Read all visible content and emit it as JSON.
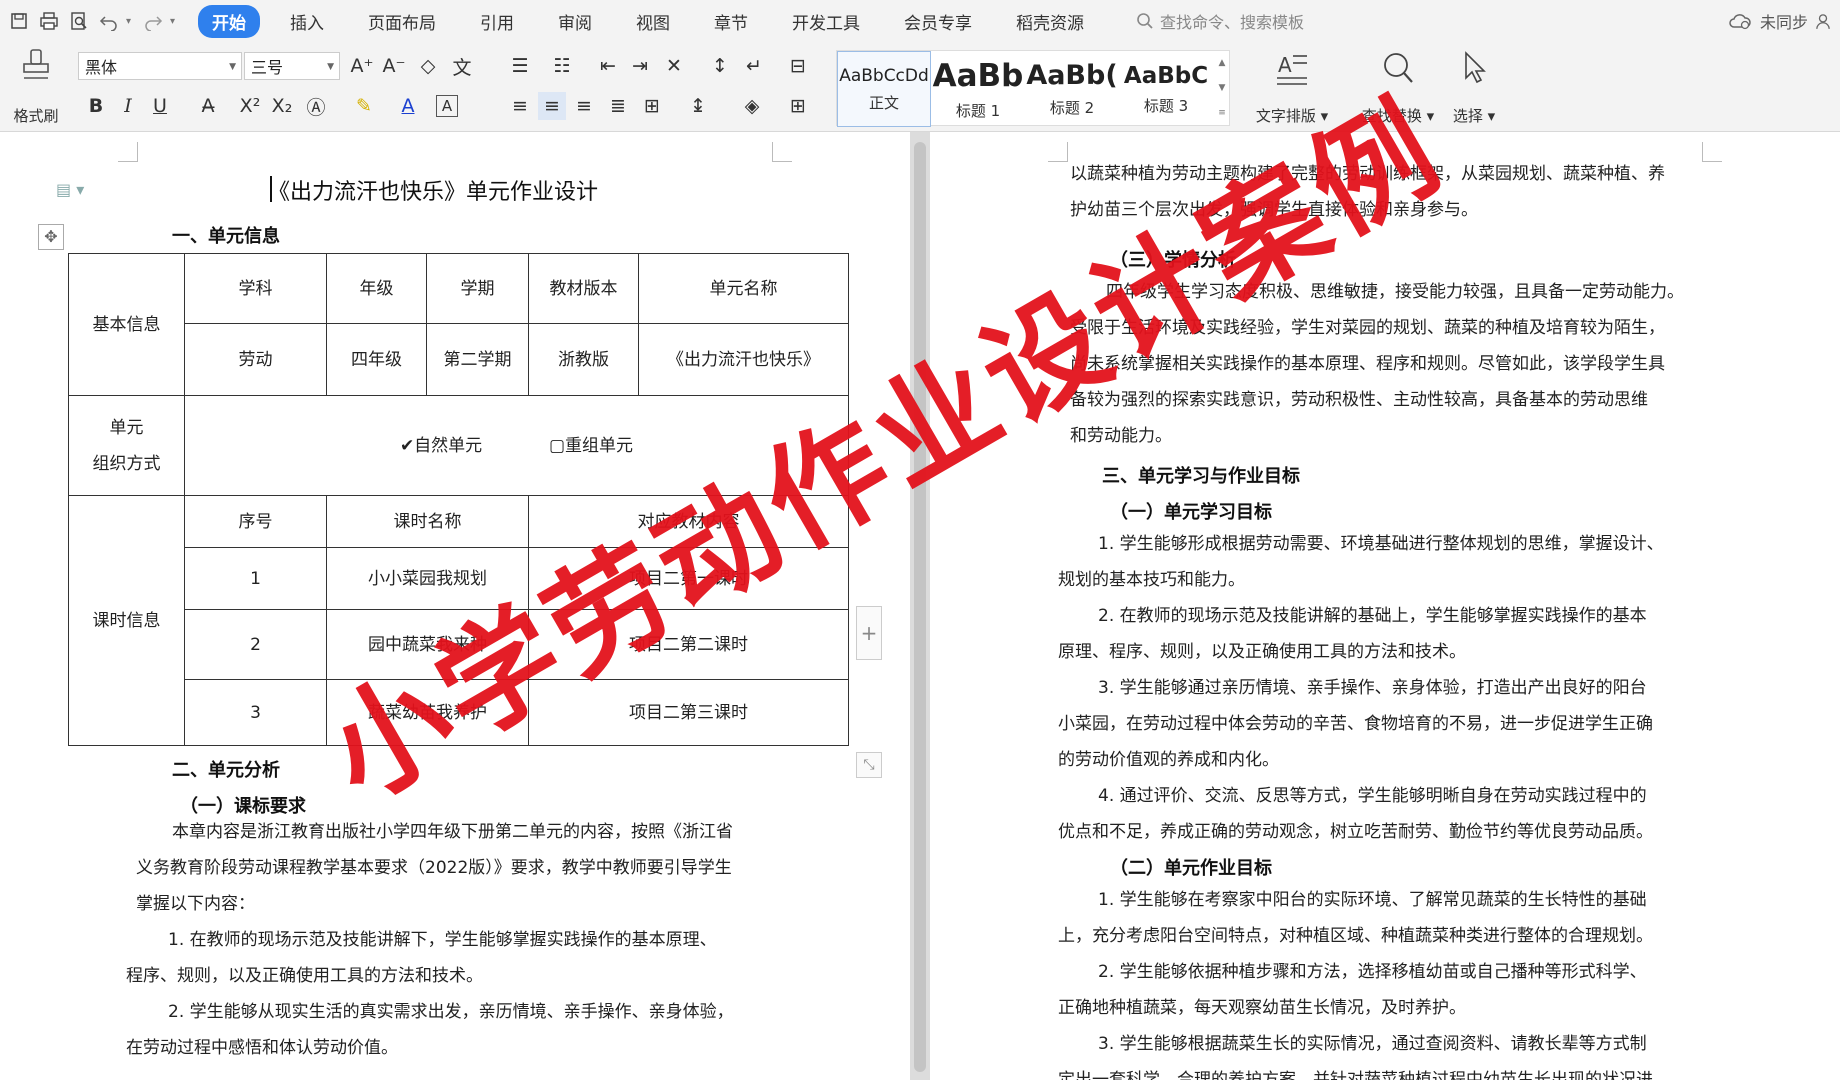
{
  "menubar": {
    "tabs": [
      {
        "label": "开始",
        "active": true
      },
      {
        "label": "插入"
      },
      {
        "label": "页面布局"
      },
      {
        "label": "引用"
      },
      {
        "label": "审阅"
      },
      {
        "label": "视图"
      },
      {
        "label": "章节"
      },
      {
        "label": "开发工具"
      },
      {
        "label": "会员专享"
      },
      {
        "label": "稻壳资源"
      }
    ],
    "search_placeholder": "查找命令、搜索模板",
    "sync_status": "未同步"
  },
  "ribbon": {
    "format_painter": "格式刷",
    "font_name": "黑体",
    "font_size": "三号",
    "styles": [
      {
        "preview": "AaBbCcDd",
        "name": "正文"
      },
      {
        "preview": "AaBb",
        "name": "标题 1"
      },
      {
        "preview": "AaBb(",
        "name": "标题 2"
      },
      {
        "preview": "AaBbC",
        "name": "标题 3"
      }
    ],
    "text_layout": "文字排版",
    "find_replace": "查找替换",
    "select": "选择"
  },
  "document": {
    "title": "《出力流汗也快乐》单元作业设计",
    "section1": "一、单元信息",
    "table": {
      "basic_info": "基本信息",
      "headers": [
        "学科",
        "年级",
        "学期",
        "教材版本",
        "单元名称"
      ],
      "values": [
        "劳动",
        "四年级",
        "第二学期",
        "浙教版",
        "《出力流汗也快乐》"
      ],
      "org_label_1": "单元",
      "org_label_2": "组织方式",
      "org_option_1": "✔自然单元",
      "org_option_2": "▢重组单元",
      "lesson_info": "课时信息",
      "lesson_headers": [
        "序号",
        "课时名称",
        "对应教材内容"
      ],
      "lessons": [
        {
          "no": "1",
          "name": "小小菜园我规划",
          "content": "项目二第一课时"
        },
        {
          "no": "2",
          "name": "园中蔬菜我来种",
          "content": "项目二第二课时"
        },
        {
          "no": "3",
          "name": "蔬菜幼苗我养护",
          "content": "项目二第三课时"
        }
      ]
    },
    "section2": "二、单元分析",
    "sub1": "（一）课标要求",
    "left_paras": [
      "本章内容是浙江教育出版社小学四年级下册第二单元的内容，按照《浙江省",
      "义务教育阶段劳动课程教学基本要求（2022版）》要求，教学中教师要引导学生",
      "掌握以下内容：",
      "1.  在教师的现场示范及技能讲解下，学生能够掌握实践操作的基本原理、",
      "程序、规则，以及正确使用工具的方法和技术。",
      "2.  学生能够从现实生活的真实需求出发，亲历情境、亲手操作、亲身体验，",
      "在劳动过程中感悟和体认劳动价值。"
    ],
    "right_top": [
      "以蔬菜种植为劳动主题构建了完整的劳动训练框架，从菜园规划、蔬菜种植、养",
      "护幼苗三个层次出发，强调学生直接体验和亲身参与。"
    ],
    "sub3": "（三）学情分析",
    "right_learn": [
      "四年级学生学习态度积极、思维敏捷，接受能力较强，且具备一定劳动能力。",
      "受限于生活环境及实践经验，学生对菜园的规划、蔬菜的种植及培育较为陌生，",
      "尚未系统掌握相关实践操作的基本原理、程序和规则。尽管如此，该学段学生具",
      "备较为强烈的探索实践意识，劳动积极性、主动性较高，具备基本的劳动思维",
      "和劳动能力。"
    ],
    "section3": "三、单元学习与作业目标",
    "sub4": "（一）单元学习目标",
    "right_goals": [
      "1.  学生能够形成根据劳动需要、环境基础进行整体规划的思维，掌握设计、",
      "规划的基本技巧和能力。",
      "2.  在教师的现场示范及技能讲解的基础上，学生能够掌握实践操作的基本",
      "原理、程序、规则，以及正确使用工具的方法和技术。",
      "3.  学生能够通过亲历情境、亲手操作、亲身体验，打造出产出良好的阳台",
      "小菜园，在劳动过程中体会劳动的辛苦、食物培育的不易，进一步促进学生正确",
      "的劳动价值观的养成和内化。",
      "4.  通过评价、交流、反思等方式，学生能够明晰自身在劳动实践过程中的",
      "优点和不足，养成正确的劳动观念，树立吃苦耐劳、勤俭节约等优良劳动品质。"
    ],
    "sub5": "（二）单元作业目标",
    "right_hw": [
      "1.  学生能够在考察家中阳台的实际环境、了解常见蔬菜的生长特性的基础",
      "上，充分考虑阳台空间特点，对种植区域、种植蔬菜种类进行整体的合理规划。",
      "2.  学生能够依据种植步骤和方法，选择移植幼苗或自己播种等形式科学、",
      "正确地种植蔬菜，每天观察幼苗生长情况，及时养护。",
      "3.  学生能够根据蔬菜生长的实际情况，通过查阅资料、请教长辈等方式制",
      "定出一套科学、合理的养护方案，并针对蔬菜种植过程中幼苗生长出现的状况进"
    ]
  },
  "watermark": "小学劳动作业设计案例"
}
